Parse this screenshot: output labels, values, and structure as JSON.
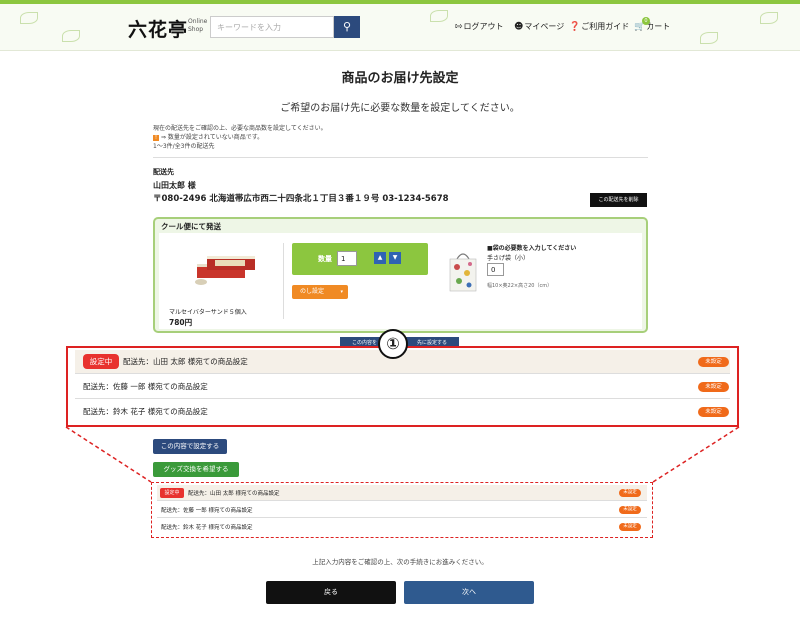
{
  "header": {
    "logo": "六花亭",
    "logo_sub_1": "Online",
    "logo_sub_2": "Shop",
    "search_placeholder": "キーワードを入力",
    "nav": {
      "logout": "ログアウト",
      "mypage": "マイページ",
      "guide": "ご利用ガイド",
      "cart": "カート",
      "cart_count": "0"
    }
  },
  "page": {
    "title": "商品のお届け先設定",
    "subtitle": "ご希望のお届け先に必要な数量を設定してください。",
    "notes": {
      "line1": "現在の配送先をご確認の上、必要な商品数を設定してください。",
      "line2": "⇒ 数量が設定されていない商品です。",
      "line3": "1～3件/全3件の配送先"
    }
  },
  "destination": {
    "label": "配送先",
    "name": "山田太郎 様",
    "address": "〒080-2496 北海道帯広市西二十四条北１丁目３番１９号 03-1234-5678",
    "delete_button": "この配送先を削除"
  },
  "cool_delivery": {
    "heading": "クール便にて発送",
    "product": {
      "name": "マルセイバターサンド５個入",
      "price": "780円"
    },
    "quantity": {
      "label": "数量",
      "value": "1"
    },
    "noshi_button": "のし設定",
    "bag": {
      "title": "■袋の必要数を入力してください",
      "name": "手さげ袋（小）",
      "qty": "0",
      "size": "幅10×奥22×高さ20（cm）"
    }
  },
  "obscured_button": {
    "left": "この内容を",
    "right": "先に設定する"
  },
  "callout_number": "①",
  "recipients": [
    {
      "active_tag": "設定中",
      "text": "配送先：山田 太郎 様宛ての商品設定",
      "status": "未設定"
    },
    {
      "active_tag": "",
      "text": "配送先：佐藤 一郎 様宛ての商品設定",
      "status": "未設定"
    },
    {
      "active_tag": "",
      "text": "配送先：鈴木 花子 様宛ての商品設定",
      "status": "未設定"
    }
  ],
  "buttons": {
    "set_content": "この内容で設定する",
    "goods_exchange": "グッズ交換を希望する",
    "back": "戻る",
    "next": "次へ"
  },
  "confirm_text": "上記入力内容をご確認の上、次の手続きにお進みください。",
  "colors": {
    "accent_green": "#8cc63f",
    "navy": "#2c4a7d",
    "red": "#dd2222",
    "orange": "#f06a1a"
  }
}
